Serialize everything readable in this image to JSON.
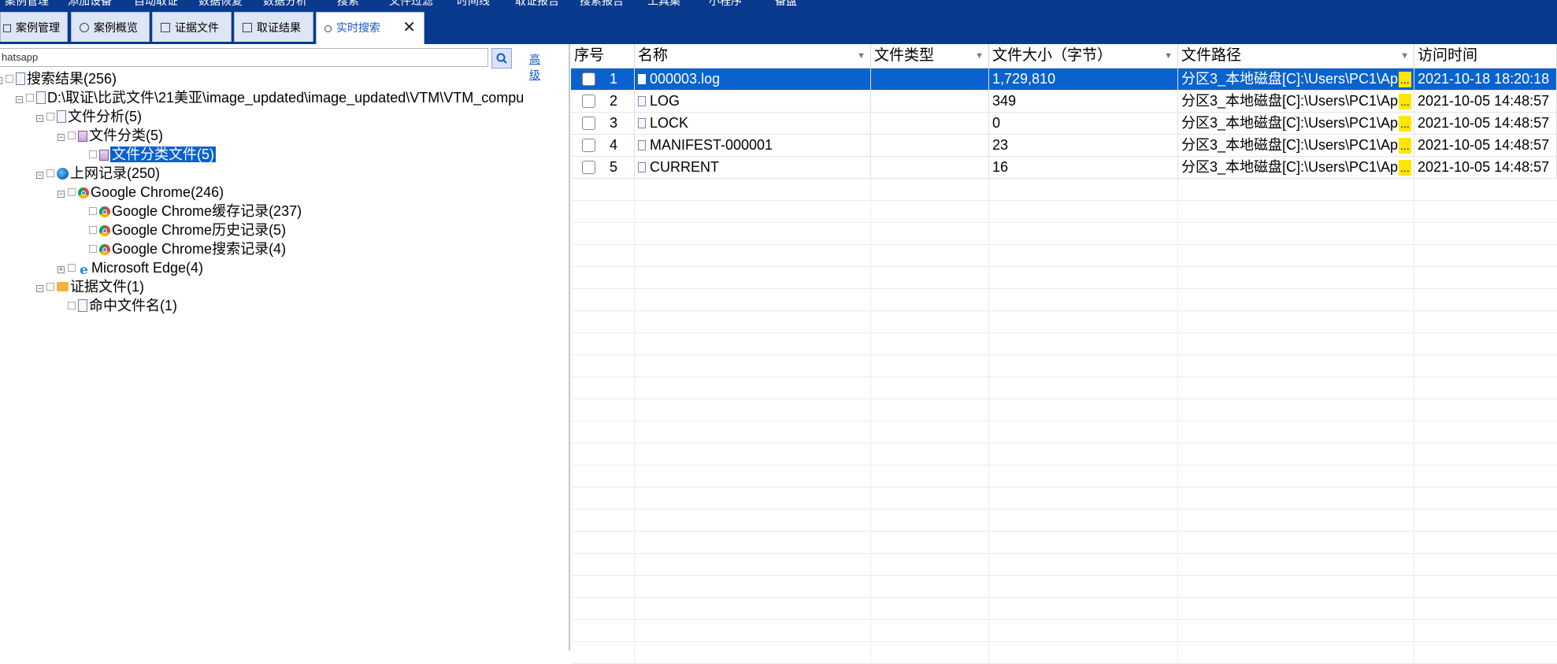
{
  "menu": [
    "案例管理",
    "添加设备",
    "自动取证",
    "数据恢复",
    "数据分析",
    "搜索",
    "文件过滤",
    "时间线",
    "取证报告",
    "搜索报告",
    "工具集",
    "小程序",
    "备盘"
  ],
  "tabs": [
    {
      "label": "案例管理",
      "icon": "edit-icon"
    },
    {
      "label": "案例概览",
      "icon": "pie-icon"
    },
    {
      "label": "证据文件",
      "icon": "evidence-icon"
    },
    {
      "label": "取证结果",
      "icon": "result-icon"
    },
    {
      "label": "实时搜索",
      "icon": "search-icon",
      "active": true
    }
  ],
  "search": {
    "value": "hatsapp",
    "advanced": "高级"
  },
  "tree": [
    {
      "label": "搜索结果(256)",
      "icon": "doc-icon"
    },
    {
      "label": "D:\\取证\\比武文件\\21美亚\\image_updated\\image_updated\\VTM\\VTM_compu",
      "icon": "doc-icon"
    },
    {
      "label": "文件分析(5)",
      "icon": "edit-doc-icon"
    },
    {
      "label": "文件分类(5)",
      "icon": "classify-icon"
    },
    {
      "label": "文件分类文件(5)",
      "icon": "classify-icon"
    },
    {
      "label": "上网记录(250)",
      "icon": "globe-icon"
    },
    {
      "label": "Google Chrome(246)",
      "icon": "chrome-icon"
    },
    {
      "label": "Google Chrome缓存记录(237)",
      "icon": "chrome-icon"
    },
    {
      "label": "Google Chrome历史记录(5)",
      "icon": "chrome-icon"
    },
    {
      "label": "Google Chrome搜索记录(4)",
      "icon": "chrome-icon"
    },
    {
      "label": "Microsoft Edge(4)",
      "icon": "edge-icon"
    },
    {
      "label": "证据文件(1)",
      "icon": "folder-icon"
    },
    {
      "label": "命中文件名(1)",
      "icon": "doc-icon"
    }
  ],
  "columns": [
    "序号",
    "名称",
    "文件类型",
    "文件大小（字节）",
    "文件路径",
    "访问时间"
  ],
  "rows": [
    {
      "no": "1",
      "name": "000003.log",
      "type": "",
      "size": "1,729,810",
      "path": "分区3_本地磁盘[C]:\\Users\\PC1\\Ap",
      "time": "2021-10-18 18:20:18"
    },
    {
      "no": "2",
      "name": "LOG",
      "type": "",
      "size": "349",
      "path": "分区3_本地磁盘[C]:\\Users\\PC1\\Ap",
      "time": "2021-10-05 14:48:57"
    },
    {
      "no": "3",
      "name": "LOCK",
      "type": "",
      "size": "0",
      "path": "分区3_本地磁盘[C]:\\Users\\PC1\\Ap",
      "time": "2021-10-05 14:48:57"
    },
    {
      "no": "4",
      "name": "MANIFEST-000001",
      "type": "",
      "size": "23",
      "path": "分区3_本地磁盘[C]:\\Users\\PC1\\Ap",
      "time": "2021-10-05 14:48:57"
    },
    {
      "no": "5",
      "name": "CURRENT",
      "type": "",
      "size": "16",
      "path": "分区3_本地磁盘[C]:\\Users\\PC1\\Ap",
      "time": "2021-10-05 14:48:57"
    }
  ],
  "ellipsis": "..."
}
